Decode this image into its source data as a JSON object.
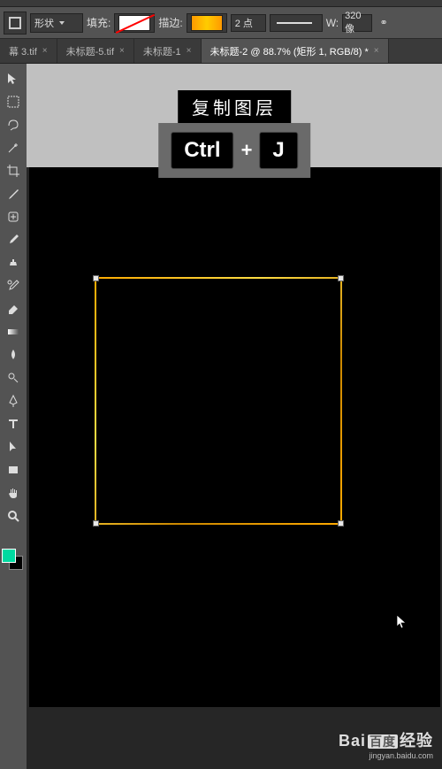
{
  "options_bar": {
    "shape_mode": "形状",
    "fill_label": "填充:",
    "stroke_label": "描边:",
    "stroke_width": "2 点",
    "w_label": "W:",
    "w_value": "320 像",
    "link_glyph": "⚭"
  },
  "tabs": [
    {
      "label": "幕 3.tif",
      "active": false
    },
    {
      "label": "未标题-5.tif",
      "active": false
    },
    {
      "label": "未标题-1",
      "active": false
    },
    {
      "label": "未标题-2 @ 88.7% (矩形 1, RGB/8) *",
      "active": true
    }
  ],
  "tooltip": {
    "title": "复制图层",
    "key1": "Ctrl",
    "plus": "+",
    "key2": "J"
  },
  "tool_names": [
    "move-tool",
    "marquee-tool",
    "lasso-tool",
    "magic-wand-tool",
    "crop-tool",
    "eyedropper-tool",
    "spot-heal-tool",
    "brush-tool",
    "clone-stamp-tool",
    "history-brush-tool",
    "eraser-tool",
    "gradient-tool",
    "blur-tool",
    "dodge-tool",
    "pen-tool",
    "type-tool",
    "path-select-tool",
    "rectangle-tool",
    "hand-tool",
    "zoom-tool"
  ],
  "watermark": {
    "brand_left": "Bai",
    "brand_mid": "百度",
    "brand_right": "经验",
    "sub": "jingyan.baidu.com"
  }
}
